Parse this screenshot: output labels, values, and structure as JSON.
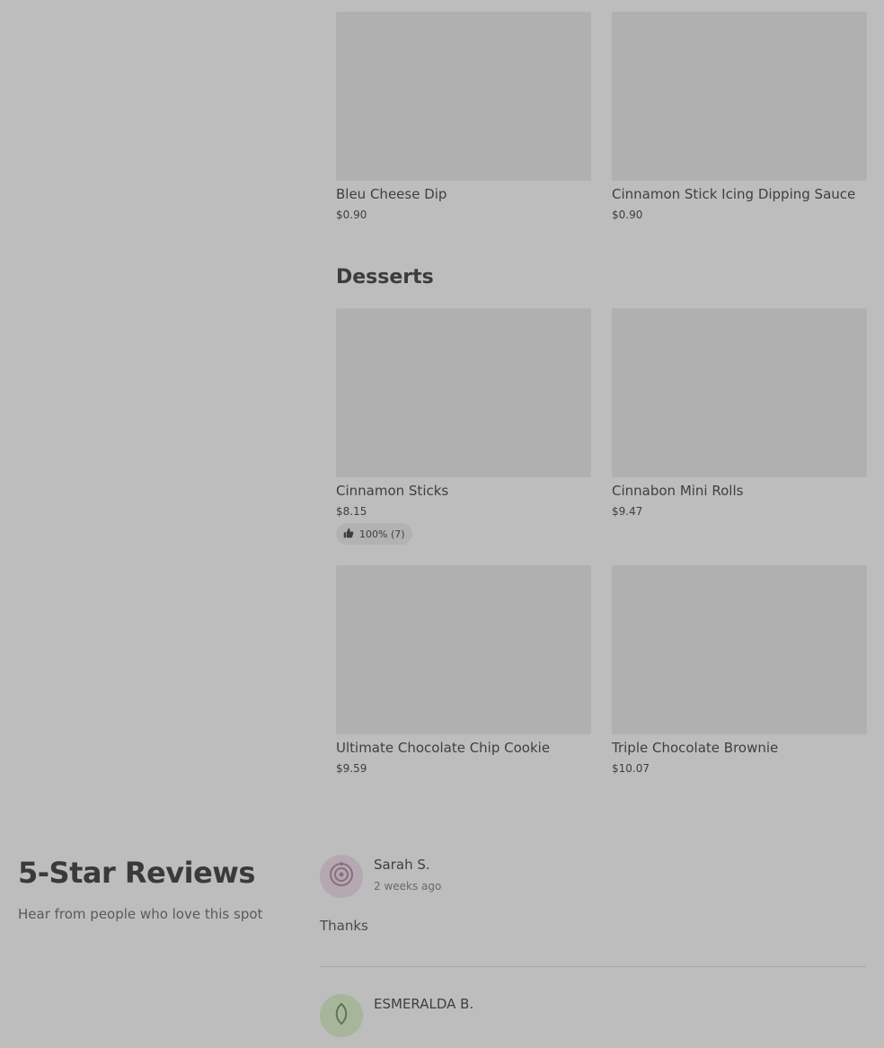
{
  "menu": {
    "top_items": [
      {
        "name": "Bleu Cheese Dip",
        "price": "$0.90"
      },
      {
        "name": "Cinnamon Stick Icing Dipping Sauce",
        "price": "$0.90"
      }
    ],
    "desserts": {
      "title": "Desserts",
      "items": [
        {
          "name": "Cinnamon Sticks",
          "price": "$8.15",
          "rating": "100% (7)"
        },
        {
          "name": "Cinnabon Mini Rolls",
          "price": "$9.47"
        },
        {
          "name": "Ultimate Chocolate Chip Cookie",
          "price": "$9.59"
        },
        {
          "name": "Triple Chocolate Brownie",
          "price": "$10.07"
        }
      ]
    }
  },
  "reviews": {
    "title": "5-Star Reviews",
    "subtitle": "Hear from people who love this spot",
    "items": [
      {
        "name": "Sarah S.",
        "when": "2 weeks ago",
        "text": "Thanks",
        "avatar_color": "#b5a8b1",
        "avatar_icon": "target-icon"
      },
      {
        "name": "ESMERALDA B.",
        "avatar_color": "#a7b59a",
        "avatar_icon": "leaf-icon"
      }
    ]
  },
  "icons": {
    "thumbs_up": "thumbs-up-icon"
  }
}
